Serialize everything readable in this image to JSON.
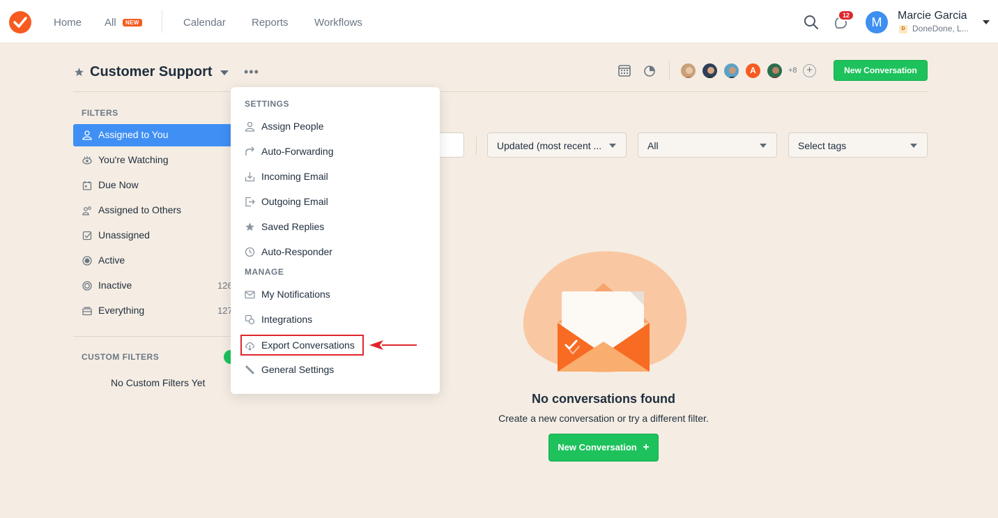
{
  "nav": {
    "home": "Home",
    "all": "All",
    "all_badge": "NEW",
    "calendar": "Calendar",
    "reports": "Reports",
    "workflows": "Workflows",
    "notification_count": "12"
  },
  "user": {
    "initial": "M",
    "name": "Marcie Garcia",
    "org_initial": "D",
    "org": "DoneDone, L..."
  },
  "header": {
    "title": "Customer Support",
    "more_members": "+8",
    "new_conversation": "New Conversation",
    "member_a_initial": "A"
  },
  "sidebar": {
    "filters_heading": "FILTERS",
    "items": [
      {
        "label": "Assigned to You",
        "count": ""
      },
      {
        "label": "You're Watching",
        "count": ""
      },
      {
        "label": "Due Now",
        "count": ""
      },
      {
        "label": "Assigned to Others",
        "count": ""
      },
      {
        "label": "Unassigned",
        "count": ""
      },
      {
        "label": "Active",
        "count": ""
      },
      {
        "label": "Inactive",
        "count": "126"
      },
      {
        "label": "Everything",
        "count": "127"
      }
    ],
    "custom_heading": "CUSTOM FILTERS",
    "no_custom": "No Custom Filters Yet"
  },
  "filters": {
    "sort": "Updated (most recent ...",
    "status": "All",
    "tags_placeholder": "Select tags"
  },
  "menu": {
    "settings_heading": "SETTINGS",
    "settings_items": [
      "Assign People",
      "Auto-Forwarding",
      "Incoming Email",
      "Outgoing Email",
      "Saved Replies",
      "Auto-Responder"
    ],
    "manage_heading": "MANAGE",
    "manage_items": [
      "My Notifications",
      "Integrations",
      "Export Conversations",
      "General Settings"
    ]
  },
  "empty_state": {
    "title": "No conversations found",
    "subtitle": "Create a new conversation or try a different filter.",
    "button": "New Conversation"
  },
  "colors": {
    "brand_orange": "#f75b20",
    "primary_blue": "#3f8ff5",
    "success_green": "#1dc25c",
    "highlight_red": "#e0262d",
    "background": "#f5ede3"
  }
}
